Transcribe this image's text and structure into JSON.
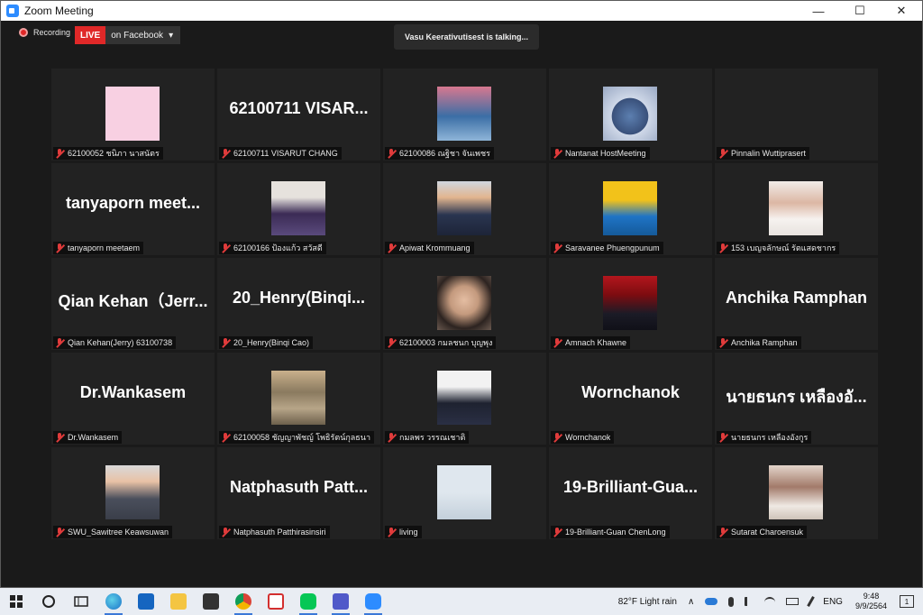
{
  "window": {
    "title": "Zoom Meeting",
    "minimize": "—",
    "maximize": "☐",
    "close": "✕"
  },
  "topbar": {
    "recording": "Recording",
    "live": "LIVE",
    "live_target": "on Facebook",
    "dropdown": "▾",
    "talking": "Vasu Keerativutisest is talking..."
  },
  "tiles": [
    {
      "big": "",
      "label": "62100052 ชนิภา  นาสนัตร",
      "photo": "pink"
    },
    {
      "big": "62100711  VISAR...",
      "label": "62100711 VISARUT CHANG",
      "photo": ""
    },
    {
      "big": "",
      "label": "62100086 ณฐิชา จันเพชร",
      "photo": "crowd"
    },
    {
      "big": "",
      "label": "Nantanat HostMeeting",
      "photo": "shark"
    },
    {
      "big": "",
      "label": "Pinnalin Wuttiprasert",
      "photo": ""
    },
    {
      "big": "tanyaporn   meet...",
      "label": "tanyaporn  meetaem",
      "photo": ""
    },
    {
      "big": "",
      "label": "62100166 ป้องแก้ว สวัสดี",
      "photo": "girl-purple"
    },
    {
      "big": "",
      "label": "Apiwat Krommuang",
      "photo": "man-suit"
    },
    {
      "big": "",
      "label": "Saravanee Phuengpunum",
      "photo": "yellow"
    },
    {
      "big": "",
      "label": "153 เบญจลักษณ์ รัตแสดชากร",
      "photo": "girl-white"
    },
    {
      "big": "Qian  Kehan（Jerr...",
      "label": "Qian Kehan(Jerry) 63100738",
      "photo": ""
    },
    {
      "big": "20_Henry(Binqi...",
      "label": "20_Henry(Binqi Cao)",
      "photo": ""
    },
    {
      "big": "",
      "label": "62100003 กมลชนก บุญพุง",
      "photo": "selfie"
    },
    {
      "big": "",
      "label": "Amnach Khawne",
      "photo": "red-man"
    },
    {
      "big": "Anchika Ramphan",
      "label": "Anchika Ramphan",
      "photo": ""
    },
    {
      "big": "Dr.Wankasem",
      "label": "Dr.Wankasem",
      "photo": ""
    },
    {
      "big": "",
      "label": "62100058 ชัญญาพัชญ์ โพธิรัตน์กุลธนา",
      "photo": "street"
    },
    {
      "big": "",
      "label": "กมลพร วรรณเชาติ",
      "photo": "woman-formal"
    },
    {
      "big": "Wornchanok",
      "label": "Wornchanok",
      "photo": ""
    },
    {
      "big": "นายธนกร เหลืองอั...",
      "label": "นายธนกร เหลืองอังกูร",
      "photo": ""
    },
    {
      "big": "",
      "label": "SWU_Sawitree Keawsuwan",
      "photo": "woman-grey"
    },
    {
      "big": "Natphasuth  Patt...",
      "label": "Natphasuth Patthirasinsiri",
      "photo": ""
    },
    {
      "big": "",
      "label": "living",
      "photo": "placeholder"
    },
    {
      "big": "19-Brilliant-Gua...",
      "label": "19-Brilliant-Guan ChenLong",
      "photo": ""
    },
    {
      "big": "",
      "label": "Sutarat Charoensuk",
      "photo": "drink"
    }
  ],
  "taskbar": {
    "weather": "82°F  Light rain",
    "lang": "ENG",
    "time": "9:48",
    "date": "9/9/2564",
    "notif": "1",
    "chevron": "∧"
  }
}
